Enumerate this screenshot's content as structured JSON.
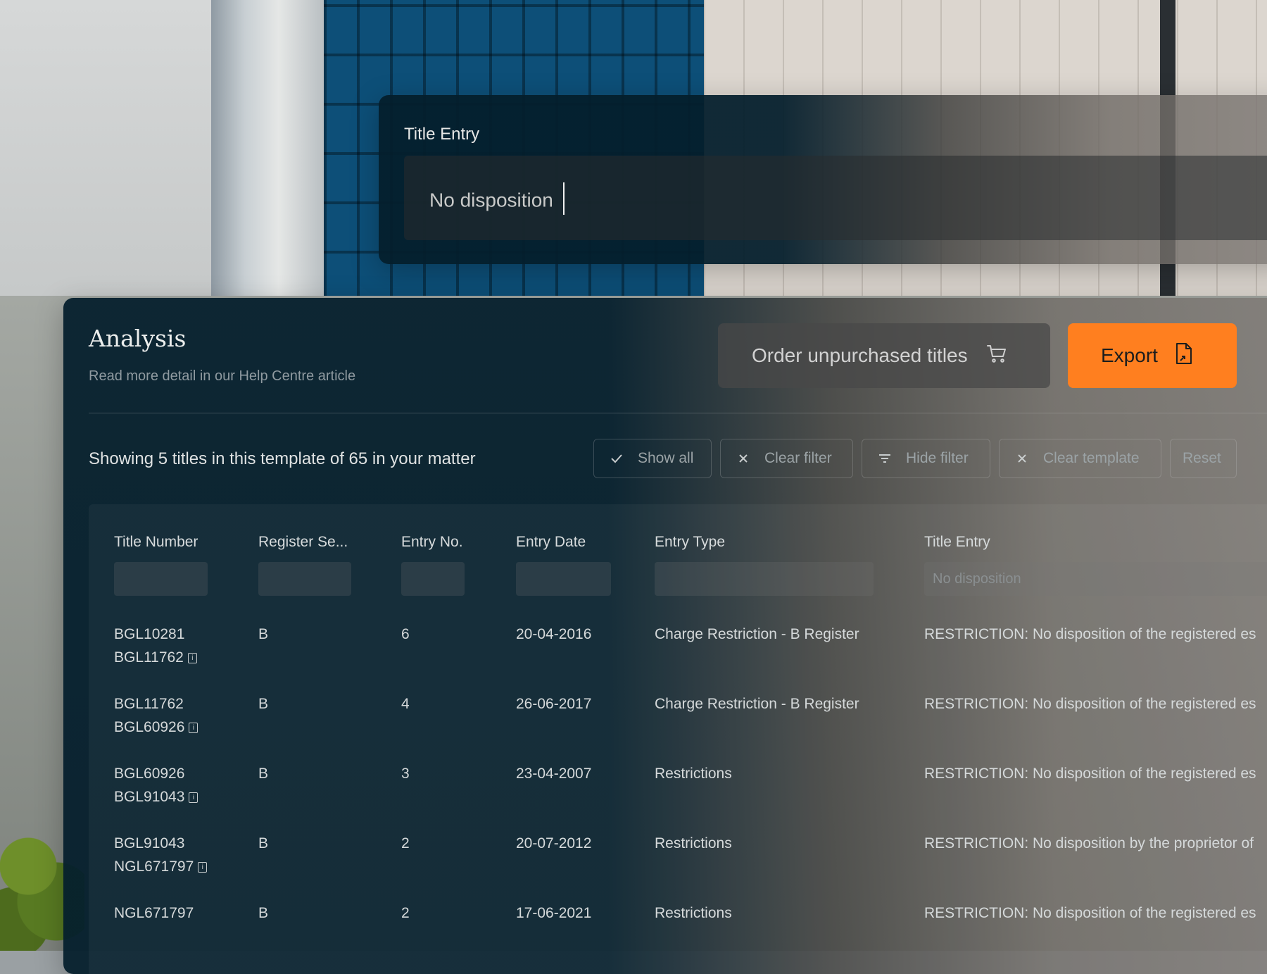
{
  "title_entry_card": {
    "label": "Title Entry",
    "input_value": "No disposition"
  },
  "analysis": {
    "title": "Analysis",
    "subtitle": "Read more detail in our Help Centre article",
    "order_button": "Order unpurchased titles",
    "export_button": "Export",
    "showing_text": "Showing 5 titles in this template of 65 in your matter",
    "chips": {
      "show_all": "Show all",
      "clear_filter": "Clear filter",
      "hide_filter": "Hide filter",
      "clear_template": "Clear template",
      "reset": "Reset"
    },
    "table": {
      "headers": [
        "Title Number",
        "Register Se...",
        "Entry No.",
        "Entry Date",
        "Entry Type",
        "Title Entry"
      ],
      "title_entry_filter": "No disposition",
      "rows": [
        {
          "title": "BGL10281",
          "linked": "BGL11762",
          "register": "B",
          "entry_no": "6",
          "date": "20-04-2016",
          "type": "Charge Restriction - B Register",
          "entry": "RESTRICTION: No disposition of the registered es"
        },
        {
          "title": "BGL11762",
          "linked": "BGL60926",
          "register": "B",
          "entry_no": "4",
          "date": "26-06-2017",
          "type": "Charge Restriction - B Register",
          "entry": "RESTRICTION: No disposition of the registered es"
        },
        {
          "title": "BGL60926",
          "linked": "BGL91043",
          "register": "B",
          "entry_no": "3",
          "date": "23-04-2007",
          "type": "Restrictions",
          "entry": "RESTRICTION: No disposition of the registered es"
        },
        {
          "title": "BGL91043",
          "linked": "NGL671797",
          "register": "B",
          "entry_no": "2",
          "date": "20-07-2012",
          "type": "Restrictions",
          "entry": "RESTRICTION: No disposition by the proprietor of"
        },
        {
          "title": "NGL671797",
          "linked": "",
          "register": "B",
          "entry_no": "2",
          "date": "17-06-2021",
          "type": "Restrictions",
          "entry": "RESTRICTION: No disposition of the registered es"
        }
      ]
    }
  },
  "colors": {
    "accent": "#ff7f1f",
    "panel_dark": "#041e2c"
  },
  "icons": [
    "cart-icon",
    "export-file-icon",
    "check-icon",
    "close-icon",
    "filter-icon",
    "info-icon"
  ]
}
